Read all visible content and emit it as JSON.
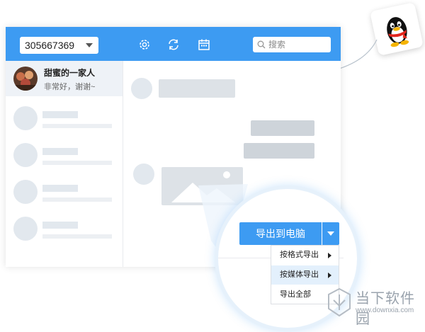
{
  "toolbar": {
    "account_number": "305667369",
    "icons": [
      "gear-icon",
      "refresh-icon",
      "calendar-icon"
    ],
    "search_placeholder": "搜索"
  },
  "sidebar": {
    "active_contact": {
      "name": "甜蜜的一家人",
      "message": "非常好，谢谢~"
    }
  },
  "export": {
    "button_label": "导出到电脑",
    "menu": [
      {
        "label": "按格式导出",
        "has_submenu": true
      },
      {
        "label": "按媒体导出",
        "has_submenu": true,
        "highlighted": true
      },
      {
        "label": "导出全部",
        "has_submenu": false
      }
    ]
  },
  "watermark": {
    "title": "当下软件园",
    "url": "www.downxia.com"
  },
  "colors": {
    "accent": "#3d9bf2",
    "placeholder": "#e2e8ee",
    "bubble": "#dde2e7",
    "bubble_dark": "#ced4da",
    "menu_highlight": "#e3f0fc"
  }
}
